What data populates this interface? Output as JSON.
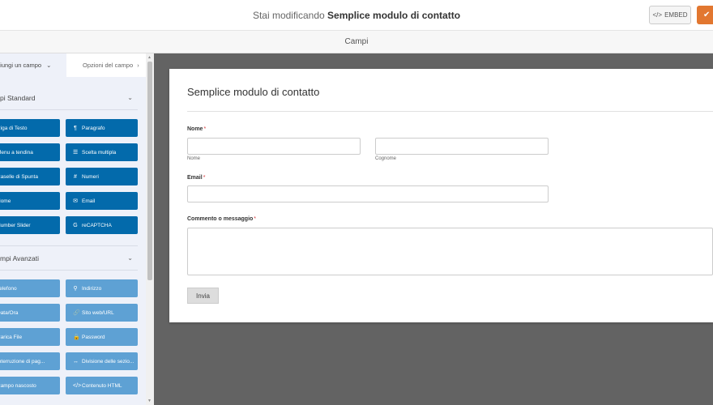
{
  "header": {
    "editing_prefix": "Stai modificando",
    "form_name": "Semplice modulo di contatto",
    "embed_label": "EMBED",
    "embed_icon": "code-icon",
    "save_icon": "check-icon"
  },
  "panel": {
    "title": "Campi"
  },
  "sidebar": {
    "tabs": [
      {
        "label": "giungi un campo",
        "icon": "chevron-down-icon"
      },
      {
        "label": "Opzioni del campo",
        "icon": "chevron-right-icon"
      }
    ],
    "standard": {
      "title": "pi Standard",
      "fields": [
        {
          "label": "Riga di Testo",
          "icon": "text-icon",
          "glyph": "⊏"
        },
        {
          "label": "Paragrafo",
          "icon": "paragraph-icon",
          "glyph": "¶"
        },
        {
          "label": "Menu a tendina",
          "icon": "dropdown-icon",
          "glyph": "▾"
        },
        {
          "label": "Scelta multipla",
          "icon": "list-icon",
          "glyph": "☰"
        },
        {
          "label": "Caselle di Spunta",
          "icon": "checkbox-icon",
          "glyph": "☑"
        },
        {
          "label": "Numeri",
          "icon": "hash-icon",
          "glyph": "#"
        },
        {
          "label": "Nome",
          "icon": "user-icon",
          "glyph": "▪"
        },
        {
          "label": "Email",
          "icon": "envelope-icon",
          "glyph": "✉"
        },
        {
          "label": "Number Slider",
          "icon": "slider-icon",
          "glyph": "≡"
        },
        {
          "label": "reCAPTCHA",
          "icon": "google-icon",
          "glyph": "G"
        }
      ]
    },
    "advanced": {
      "title": "mpi Avanzati",
      "fields": [
        {
          "label": "Telefono",
          "icon": "phone-icon",
          "glyph": "✆"
        },
        {
          "label": "Indirizzo",
          "icon": "map-marker-icon",
          "glyph": "⚲"
        },
        {
          "label": "Data/Ora",
          "icon": "calendar-icon",
          "glyph": "▦"
        },
        {
          "label": "Sito web/URL",
          "icon": "link-icon",
          "glyph": "🔗"
        },
        {
          "label": "Carica File",
          "icon": "upload-icon",
          "glyph": "⇪"
        },
        {
          "label": "Password",
          "icon": "lock-icon",
          "glyph": "🔒"
        },
        {
          "label": "Interruzione di pag...",
          "icon": "page-break-icon",
          "glyph": "⎘"
        },
        {
          "label": "Divisione delle sezio...",
          "icon": "divider-icon",
          "glyph": "↔"
        },
        {
          "label": "Campo nascosto",
          "icon": "eye-slash-icon",
          "glyph": "◌"
        },
        {
          "label": "Contenuto HTML",
          "icon": "code-icon",
          "glyph": "</>"
        }
      ]
    }
  },
  "form": {
    "title": "Semplice modulo di contatto",
    "name_label": "Nome",
    "required_mark": "*",
    "first_sublabel": "Nome",
    "last_sublabel": "Cognome",
    "email_label": "Email",
    "message_label": "Commento o messaggio",
    "submit_label": "Invia"
  },
  "colors": {
    "standard_button": "#036aab",
    "advanced_button": "#5ea1d4",
    "save_button": "#e27730",
    "canvas_background": "#636363"
  }
}
